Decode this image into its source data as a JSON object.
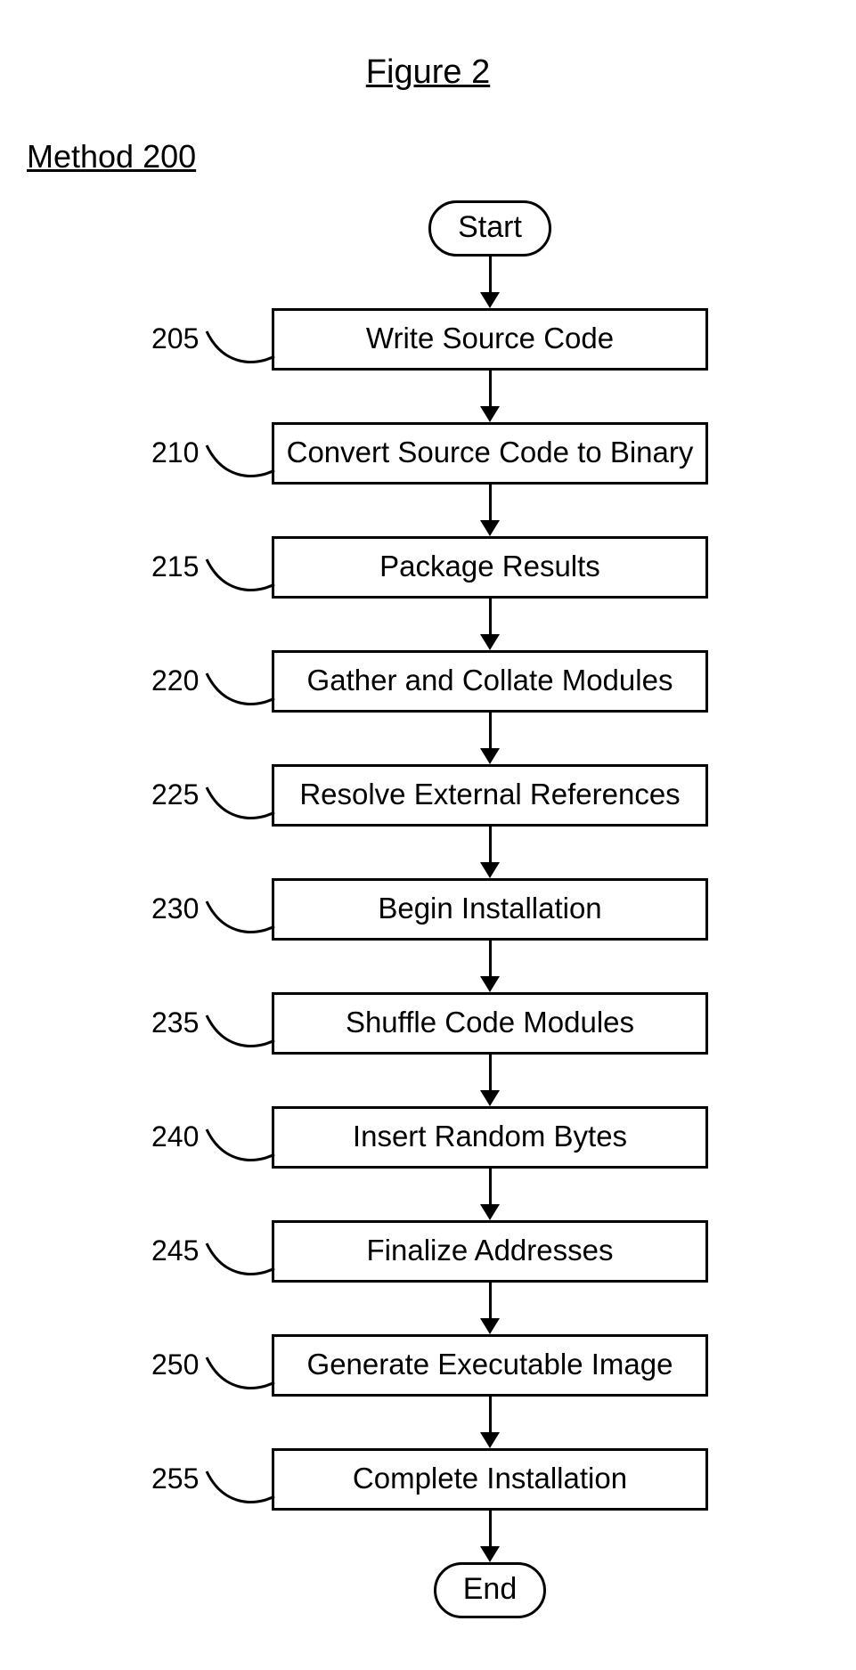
{
  "figure_title": "Figure 2",
  "method_title": "Method 200",
  "start": "Start",
  "end": "End",
  "steps": [
    {
      "ref": "205",
      "label": "Write Source Code"
    },
    {
      "ref": "210",
      "label": "Convert Source Code to Binary"
    },
    {
      "ref": "215",
      "label": "Package Results"
    },
    {
      "ref": "220",
      "label": "Gather and Collate Modules"
    },
    {
      "ref": "225",
      "label": "Resolve External References"
    },
    {
      "ref": "230",
      "label": "Begin Installation"
    },
    {
      "ref": "235",
      "label": "Shuffle Code Modules"
    },
    {
      "ref": "240",
      "label": "Insert Random Bytes"
    },
    {
      "ref": "245",
      "label": "Finalize Addresses"
    },
    {
      "ref": "250",
      "label": "Generate Executable Image"
    },
    {
      "ref": "255",
      "label": "Complete Installation"
    }
  ]
}
